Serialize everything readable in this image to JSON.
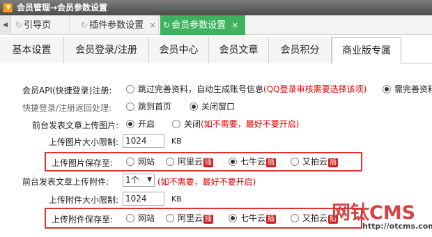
{
  "title": {
    "text": "会员管理→会员参数设置",
    "icon": "download-icon"
  },
  "open_tabs": [
    {
      "label": "引导页",
      "icon": "refresh-icon",
      "closable": false,
      "active": false
    },
    {
      "label": "插件参数设置",
      "icon": "refresh-icon",
      "closable": true,
      "active": false
    },
    {
      "label": "会员参数设置",
      "icon": "refresh-icon",
      "closable": true,
      "active": true
    }
  ],
  "close_glyph": "×",
  "section_tabs": [
    {
      "label": "基本设置",
      "active": false
    },
    {
      "label": "会员登录/注册",
      "active": false
    },
    {
      "label": "会员中心",
      "active": false
    },
    {
      "label": "会员文章",
      "active": false
    },
    {
      "label": "会员积分",
      "active": false
    },
    {
      "label": "商业版专属",
      "active": true
    }
  ],
  "form": {
    "api_register": {
      "label": "会员API(快捷登录)注册:",
      "opt1": "跳过完善资料，自动生成账号信息",
      "opt1_note": "(QQ登录审核需要选择该项)",
      "opt2": "需完善资料"
    },
    "return_handle": {
      "label": "快捷登录/注册返回处理:",
      "opt1": "跳到首页",
      "opt2": "关闭窗口"
    },
    "upload_image": {
      "label": "前台发表文章上传图片:",
      "opt1": "开启",
      "opt2": "关闭",
      "note": "(如不需要，最好不要开启)"
    },
    "image_size": {
      "label": "上传图片大小限制:",
      "value": "1024",
      "unit": "KB"
    },
    "image_save": {
      "label": "上传图片保存至:",
      "options": [
        "网站",
        "阿里云",
        "七牛云",
        "又拍云"
      ],
      "badge": "插",
      "selected": 2
    },
    "upload_attach": {
      "label": "前台发表文章上传附件:",
      "select_value": "1个",
      "note": "(如不需要，最好不要开启)"
    },
    "attach_size": {
      "label": "上传附件大小限制:",
      "value": "1024",
      "unit": "KB"
    },
    "attach_save": {
      "label": "上传附件保存至:",
      "options": [
        "网站",
        "阿里云",
        "七牛云",
        "又拍云"
      ],
      "badge": "插",
      "selected": 2
    }
  },
  "watermark": {
    "text": "网钛CMS",
    "url": "http://otcms.com"
  },
  "colors": {
    "active_tab": "#3fb25e",
    "highlight_border": "#e03030",
    "note_red": "#e00000"
  }
}
